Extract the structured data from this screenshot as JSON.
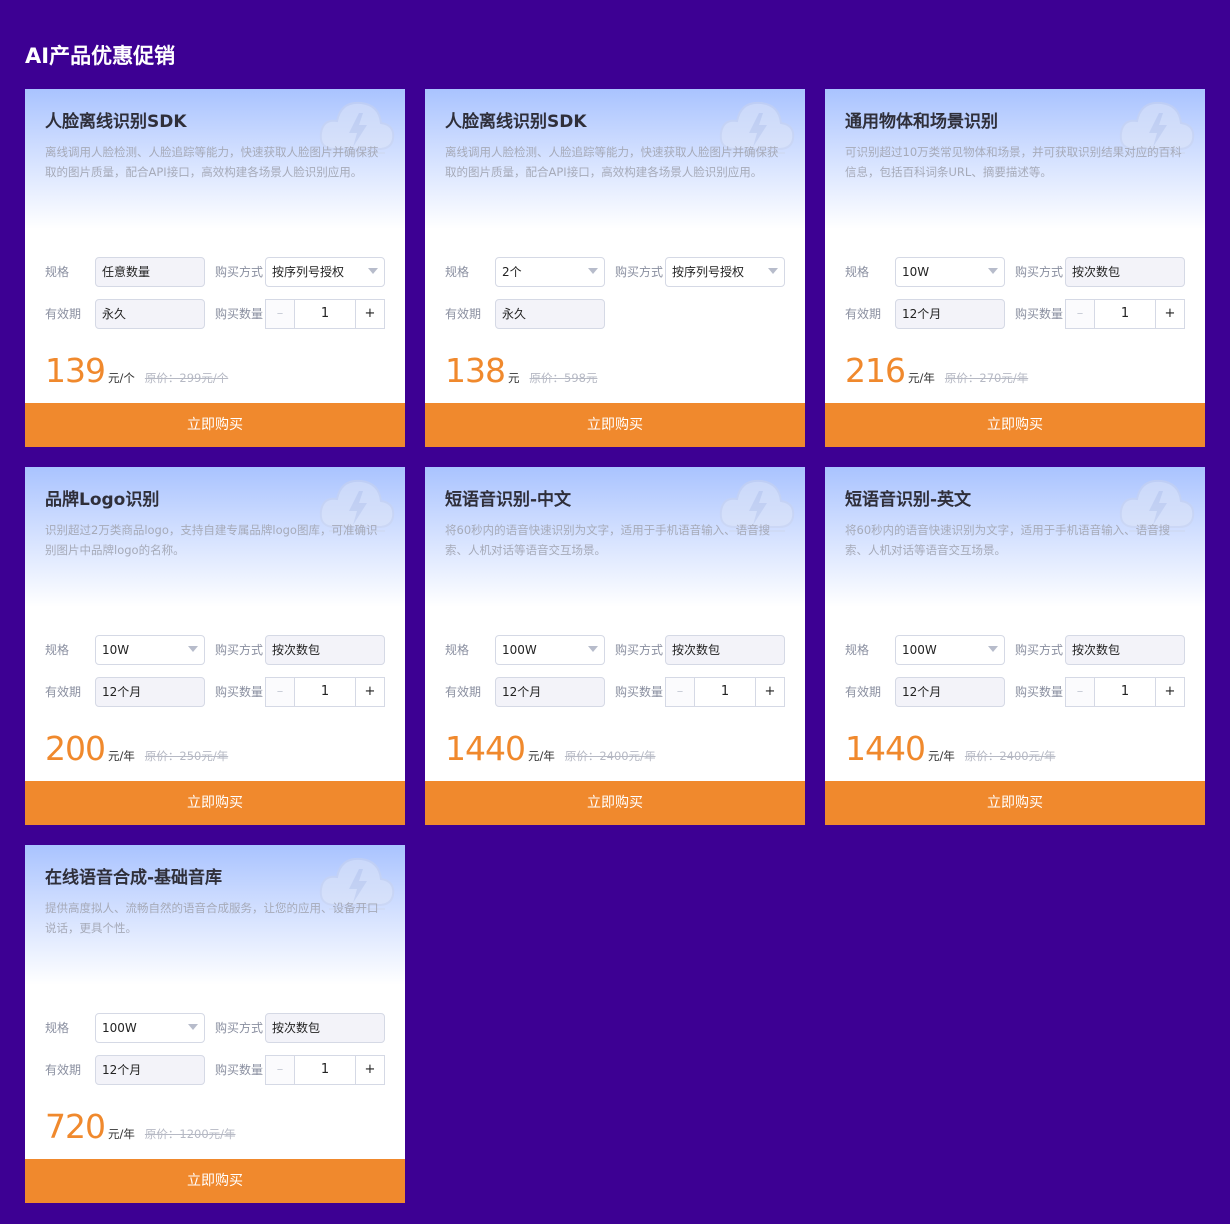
{
  "page": {
    "title": "AI产品优惠促销",
    "background": "#3d0093",
    "accent": "#f0892d"
  },
  "labels": {
    "spec": "规格",
    "purchase_method": "购买方式",
    "validity": "有效期",
    "quantity": "购买数量",
    "buy": "立即购买",
    "minus": "–",
    "plus": "+"
  },
  "cards": [
    {
      "title": "人脸离线识别SDK",
      "desc": "离线调用人脸检测、人脸追踪等能力，快速获取人脸图片并确保获取的图片质量，配合API接口，高效构建各场景人脸识别应用。",
      "spec": "任意数量",
      "method": "按序列号授权",
      "validity": "永久",
      "quantity": "1",
      "price": "139",
      "unit": "元/个",
      "original": "原价：299元/个"
    },
    {
      "title": "人脸离线识别SDK",
      "desc": "离线调用人脸检测、人脸追踪等能力，快速获取人脸图片并确保获取的图片质量，配合API接口，高效构建各场景人脸识别应用。",
      "spec": "2个",
      "method": "按序列号授权",
      "validity": "永久",
      "quantity": null,
      "price": "138",
      "unit": "元",
      "original": "原价：598元"
    },
    {
      "title": "通用物体和场景识别",
      "desc": "可识别超过10万类常见物体和场景，并可获取识别结果对应的百科信息，包括百科词条URL、摘要描述等。",
      "spec": "10W",
      "method": "按次数包",
      "validity": "12个月",
      "quantity": "1",
      "price": "216",
      "unit": "元/年",
      "original": "原价：270元/年"
    },
    {
      "title": "品牌Logo识别",
      "desc": "识别超过2万类商品logo，支持自建专属品牌logo图库，可准确识别图片中品牌logo的名称。",
      "spec": "10W",
      "method": "按次数包",
      "validity": "12个月",
      "quantity": "1",
      "price": "200",
      "unit": "元/年",
      "original": "原价：250元/年"
    },
    {
      "title": "短语音识别-中文",
      "desc": "将60秒内的语音快速识别为文字，适用于手机语音输入、语音搜索、人机对话等语音交互场景。",
      "spec": "100W",
      "method": "按次数包",
      "validity": "12个月",
      "quantity": "1",
      "price": "1440",
      "unit": "元/年",
      "original": "原价：2400元/年"
    },
    {
      "title": "短语音识别-英文",
      "desc": "将60秒内的语音快速识别为文字，适用于手机语音输入、语音搜索、人机对话等语音交互场景。",
      "spec": "100W",
      "method": "按次数包",
      "validity": "12个月",
      "quantity": "1",
      "price": "1440",
      "unit": "元/年",
      "original": "原价：2400元/年"
    },
    {
      "title": "在线语音合成-基础音库",
      "desc": "提供高度拟人、流畅自然的语音合成服务，让您的应用、设备开口说话，更具个性。",
      "spec": "100W",
      "method": "按次数包",
      "validity": "12个月",
      "quantity": "1",
      "price": "720",
      "unit": "元/年",
      "original": "原价：1200元/年"
    }
  ]
}
